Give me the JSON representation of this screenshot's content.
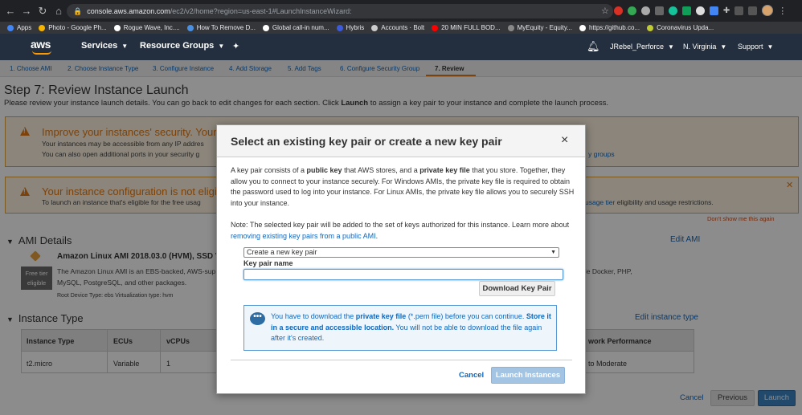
{
  "browser": {
    "url_host": "console.aws.amazon.com",
    "url_path": "/ec2/v2/home?region=us-east-1#LaunchInstanceWizard:",
    "bookmarks": [
      {
        "label": "Apps",
        "color": "#4285f4"
      },
      {
        "label": "Photo - Google Ph...",
        "color": "#f4b400"
      },
      {
        "label": "Rogue Wave, Inc....",
        "color": "#ffffff"
      },
      {
        "label": "How To Remove D...",
        "color": "#4a90e2"
      },
      {
        "label": "Global call-in num...",
        "color": "#ffffff"
      },
      {
        "label": "Hybris",
        "color": "#3b5bdb"
      },
      {
        "label": "Accounts · Bolt",
        "color": "#cccccc"
      },
      {
        "label": "20 MIN FULL BOD...",
        "color": "#ff0000"
      },
      {
        "label": "MyEquity - Equity...",
        "color": "#888888"
      },
      {
        "label": "https://github.co...",
        "color": "#ffffff"
      },
      {
        "label": "Coronavirus Upda...",
        "color": "#c0ca33"
      }
    ]
  },
  "aws_header": {
    "logo": "aws",
    "services": "Services",
    "resource_groups": "Resource Groups",
    "user": "JRebel_Perforce",
    "region": "N. Virginia",
    "support": "Support"
  },
  "steps": [
    "1. Choose AMI",
    "2. Choose Instance Type",
    "3. Configure Instance",
    "4. Add Storage",
    "5. Add Tags",
    "6. Configure Security Group",
    "7. Review"
  ],
  "page": {
    "title": "Step 7: Review Instance Launch",
    "subtitle_pre": "Please review your instance launch details. You can go back to edit changes for each section. Click ",
    "subtitle_bold": "Launch",
    "subtitle_post": " to assign a key pair to your instance and complete the launch process."
  },
  "warning1": {
    "title": "Improve your instances' security. Your se",
    "line1": "Your instances may be accessible from any IP addres",
    "line2": "You can also open additional ports in your security g",
    "right_link": "y groups"
  },
  "warning2": {
    "title": "Your instance configuration is not eligible",
    "line1": "To launch an instance that's eligible for the free usag",
    "right_link": "usage tier",
    "right_text": " eligibility and usage restrictions.",
    "dont_show": "Don't show me this again"
  },
  "ami": {
    "section": "AMI Details",
    "edit": "Edit AMI",
    "name": "Amazon Linux AMI 2018.03.0 (HVM), SSD V",
    "desc1": "The Amazon Linux AMI is an EBS-backed, AWS-sup",
    "desc1_right": "de Docker, PHP,",
    "desc2": "MySQL, PostgreSQL, and other packages.",
    "free_tier_1": "Free tier",
    "free_tier_2": "eligible",
    "meta": "Root Device Type: ebs     Virtualization type: hvm"
  },
  "instance_type": {
    "section": "Instance Type",
    "edit": "Edit instance type",
    "headers": [
      "Instance Type",
      "ECUs",
      "vCPUs",
      "work Performance"
    ],
    "row": [
      "t2.micro",
      "Variable",
      "1",
      "to Moderate"
    ]
  },
  "footer": {
    "cancel": "Cancel",
    "previous": "Previous",
    "launch": "Launch"
  },
  "modal": {
    "title": "Select an existing key pair or create a new key pair",
    "close": "×",
    "para1_a": "A key pair consists of a ",
    "para1_b": "public key",
    "para1_c": " that AWS stores, and a ",
    "para1_d": "private key file",
    "para1_e": " that you store. Together, they allow you to connect to your instance securely. For Windows AMIs, the private key file is required to obtain the password used to log into your instance. For Linux AMIs, the private key file allows you to securely SSH into your instance.",
    "note_a": "Note: The selected key pair will be added to the set of keys authorized for this instance. Learn more about ",
    "note_link": "removing existing key pairs from a public AMI",
    "note_b": ".",
    "select_value": "Create a new key pair",
    "key_pair_label": "Key pair name",
    "key_pair_value": "",
    "download_btn": "Download Key Pair",
    "info_a": "You have to download the ",
    "info_b": "private key file",
    "info_c": " (*.pem file) before you can continue. ",
    "info_d": "Store it in a secure and accessible location.",
    "info_e": " You will not be able to download the file again after it's created.",
    "cancel": "Cancel",
    "launch": "Launch Instances"
  }
}
